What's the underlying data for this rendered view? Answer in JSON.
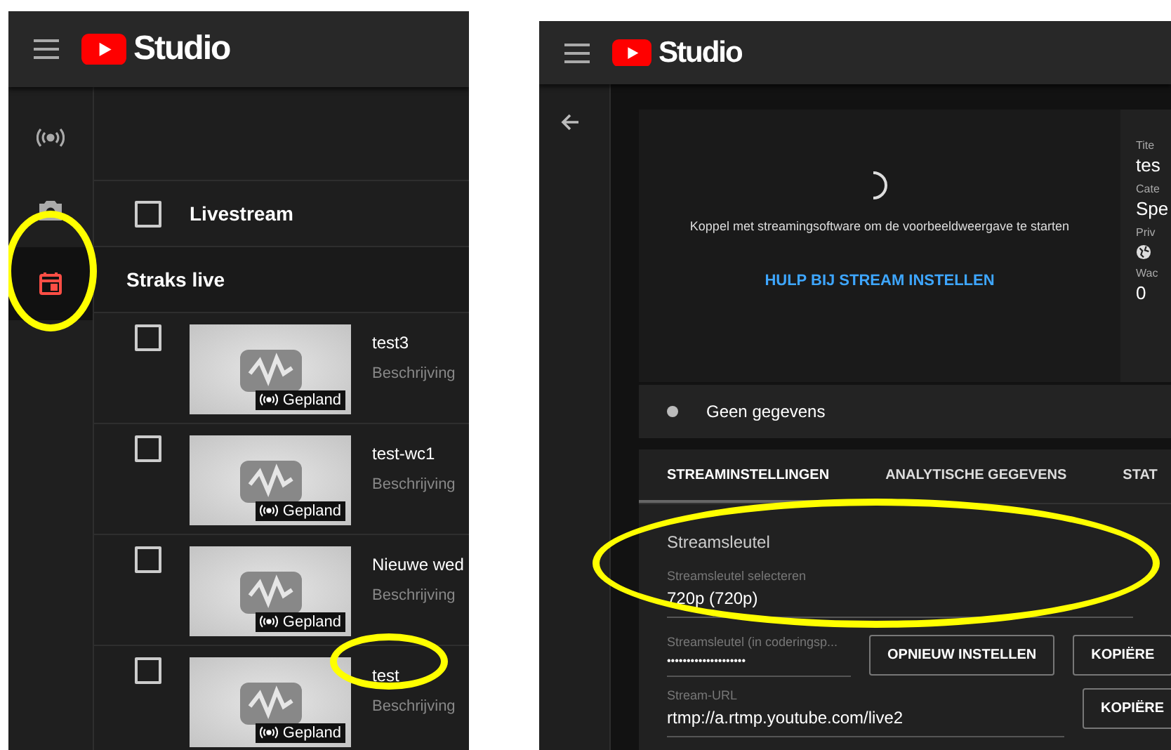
{
  "left": {
    "brand": "Studio",
    "nav": [
      {
        "kind": "live",
        "selected": false
      },
      {
        "kind": "camera",
        "selected": false
      },
      {
        "kind": "calendar",
        "selected": true
      }
    ],
    "header_row": {
      "label": "Livestream",
      "checked": false
    },
    "section": "Straks live",
    "rows": [
      {
        "title": "test3",
        "description": "Beschrijving",
        "badge": "Gepland",
        "checked": false
      },
      {
        "title": "test-wc1",
        "description": "Beschrijving",
        "badge": "Gepland",
        "checked": false
      },
      {
        "title": "Nieuwe wed",
        "description": "Beschrijving",
        "badge": "Gepland",
        "checked": false
      },
      {
        "title": "test",
        "description": "Beschrijving",
        "badge": "Gepland",
        "checked": false
      }
    ]
  },
  "right": {
    "brand": "Studio",
    "preview": {
      "message": "Koppel met streamingsoftware om de voorbeeldweergave te starten",
      "help_link": "HULP BIJ STREAM INSTELLEN"
    },
    "details": [
      {
        "kind": "text",
        "label": "Tite",
        "value": "tes"
      },
      {
        "kind": "text",
        "label": "Cate",
        "value": "Spe"
      },
      {
        "kind": "globe",
        "label": "Priv"
      },
      {
        "kind": "text",
        "label": "Wac",
        "value": "0"
      }
    ],
    "status": "Geen gegevens",
    "tabs": [
      {
        "label": "STREAMINSTELLINGEN",
        "selected": true
      },
      {
        "label": "ANALYTISCHE GEGEVENS",
        "selected": false
      },
      {
        "label": "STAT",
        "selected": false
      }
    ],
    "stream_key": {
      "heading": "Streamsleutel",
      "select_label": "Streamsleutel selecteren",
      "select_value": "720p (720p)",
      "key_label": "Streamsleutel (in coderingsp...",
      "key_value": "••••••••••••••••••••",
      "reset_button": "OPNIEUW INSTELLEN",
      "copy_button": "KOPIËRE",
      "url_label": "Stream-URL",
      "url_value": "rtmp://a.rtmp.youtube.com/live2",
      "url_copy_button": "KOPIËRE"
    }
  }
}
